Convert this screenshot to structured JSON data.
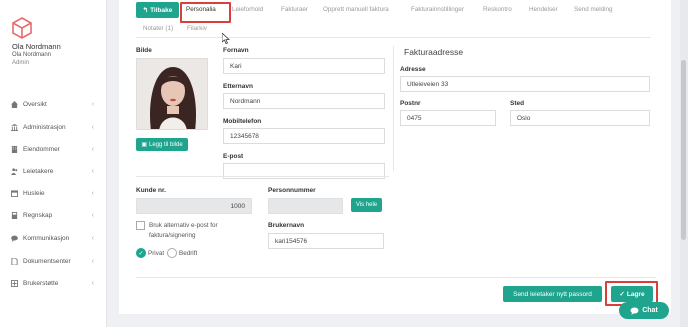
{
  "user": {
    "name": "Ola Nordmann",
    "sub": "Ola Nordmann",
    "role": "Admin"
  },
  "sidebar": {
    "items": [
      {
        "label": "Oversikt",
        "icon": "home-icon"
      },
      {
        "label": "Administrasjon",
        "icon": "bank-icon"
      },
      {
        "label": "Eiendommer",
        "icon": "building-icon"
      },
      {
        "label": "Leietakere",
        "icon": "users-icon"
      },
      {
        "label": "Husleie",
        "icon": "calendar-icon"
      },
      {
        "label": "Regnskap",
        "icon": "calculator-icon"
      },
      {
        "label": "Kommunikasjon",
        "icon": "chat-icon"
      },
      {
        "label": "Dokumentsenter",
        "icon": "file-icon"
      },
      {
        "label": "Brukerstøtte",
        "icon": "support-icon"
      }
    ]
  },
  "toolbar": {
    "back_label": "Tilbake"
  },
  "tabs": {
    "personalia": "Personalia",
    "leieforhold": "Leieforhold",
    "fakturaer": "Fakturaer",
    "manuell": "Opprett manuell faktura",
    "fakturainnstillinger": "Fakturainnstillinger",
    "reskontro": "Reskontro",
    "hendelser": "Hendelser",
    "send_melding": "Send melding",
    "notater": "Notater (1)",
    "filarkiv": "Filarkiv"
  },
  "form": {
    "bilde_label": "Bilde",
    "add_image_label": "Legg til bilde",
    "fornavn_label": "Fornavn",
    "fornavn_value": "Kari",
    "etternavn_label": "Etternavn",
    "etternavn_value": "Nordmann",
    "mobil_label": "Mobiltelefon",
    "mobil_value": "12345678",
    "epost_label": "E-post",
    "epost_value": "",
    "kunde_label": "Kunde nr.",
    "kunde_value": "1000",
    "personnummer_label": "Personnummer",
    "personnummer_value": "",
    "vis_hele_label": "Vis hele",
    "alt_epost_label_1": "Bruk alternativ e-post for",
    "alt_epost_label_2": "faktura/signering",
    "privat_label": "Privat",
    "bedrift_label": "Bedrift",
    "brukernavn_label": "Brukernavn",
    "brukernavn_value": "kari154576"
  },
  "faktura": {
    "title": "Fakturaadresse",
    "adresse_label": "Adresse",
    "adresse_value": "Utleieveien 33",
    "postnr_label": "Postnr",
    "postnr_value": "0475",
    "sted_label": "Sted",
    "sted_value": "Oslo"
  },
  "footer": {
    "reset_password_label": "Send leietaker nytt passord",
    "save_label": "Lagre",
    "chat_label": "Chat"
  },
  "colors": {
    "accent": "#1fa48e",
    "highlight": "#d9403a"
  }
}
